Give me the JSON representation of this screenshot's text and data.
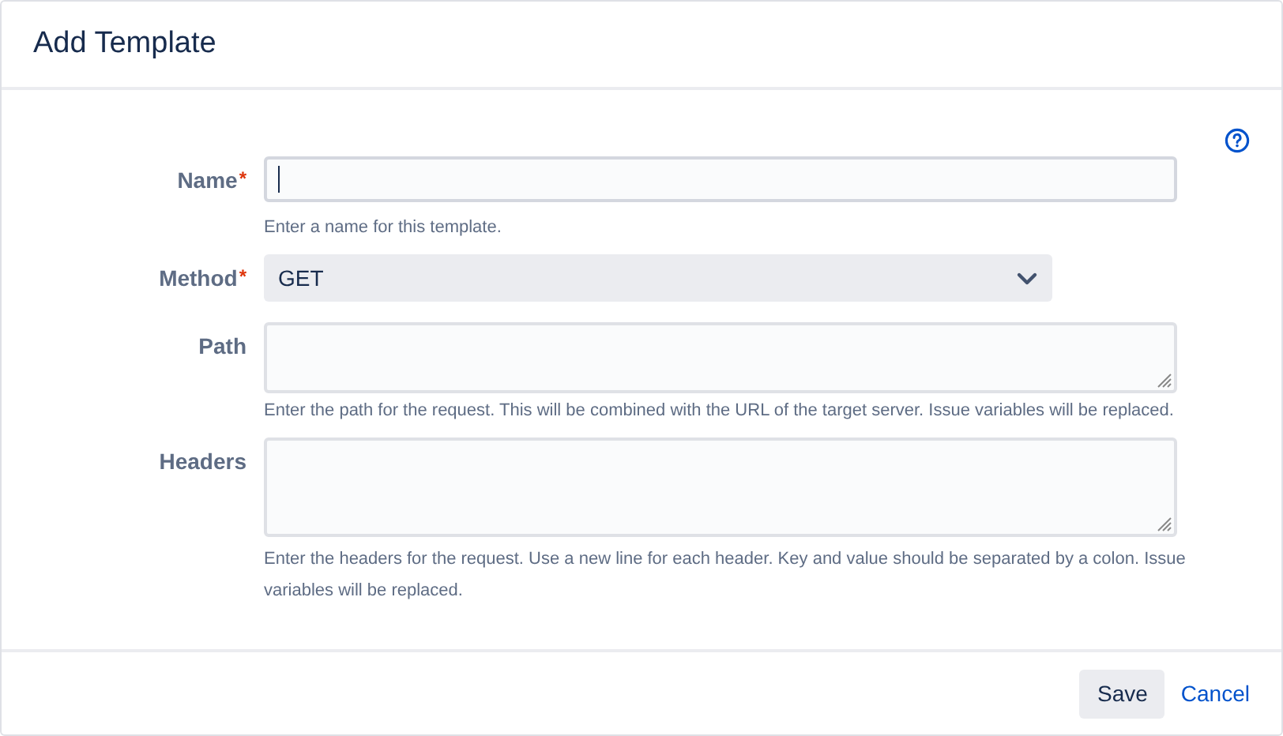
{
  "dialog": {
    "title": "Add Template"
  },
  "fields": [
    {
      "kind": "text",
      "label": "Name",
      "required_mark": "*",
      "focused": true,
      "description": "Enter a name for this template."
    },
    {
      "kind": "select",
      "label": "Method",
      "required_mark": "*",
      "value": "GET"
    },
    {
      "kind": "textarea",
      "label": "Path",
      "focused": false,
      "tall": false,
      "description": "Enter the path for the request. This will be combined with the URL of the target server. Issue variables will be replaced."
    },
    {
      "kind": "textarea",
      "label": "Headers",
      "focused": false,
      "tall": true,
      "description": "Enter the headers for the request. Use a new line for each header. Key and value should be separated by a colon. Issue variables will be replaced."
    }
  ],
  "buttons": [
    {
      "kind": "primary",
      "label": "Save"
    },
    {
      "kind": "link",
      "label": "Cancel"
    }
  ]
}
